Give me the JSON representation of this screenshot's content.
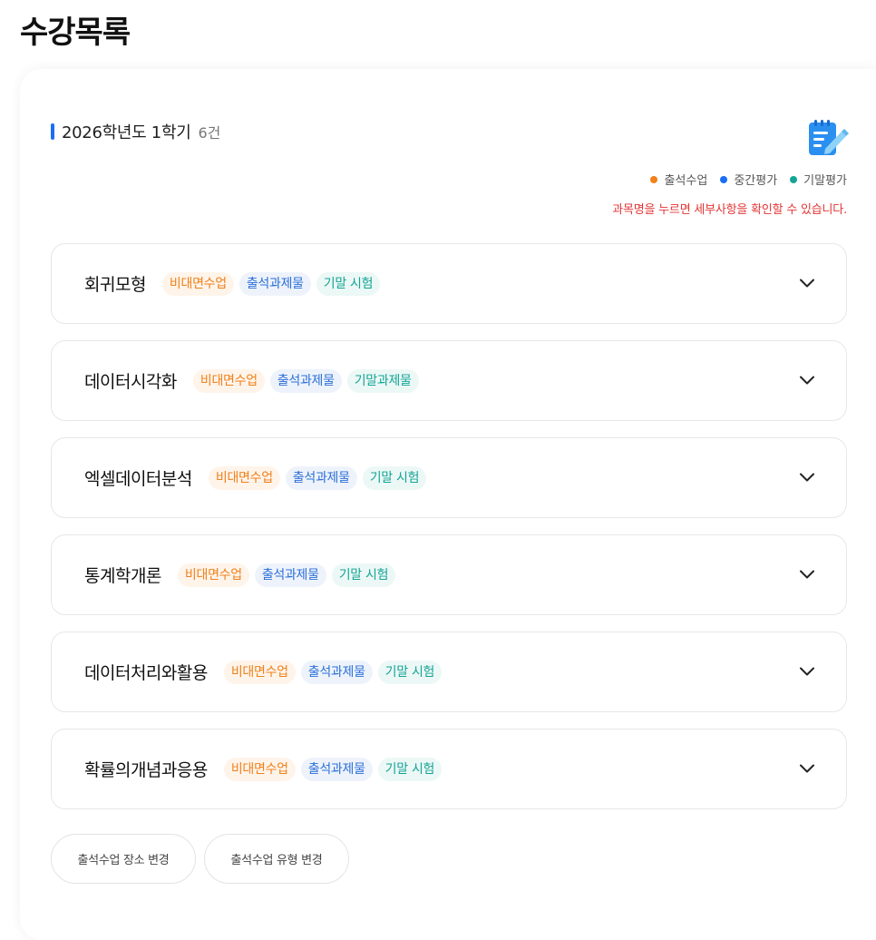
{
  "page": {
    "title": "수강목록"
  },
  "term": {
    "label": "2026학년도 1학기",
    "count": "6건"
  },
  "legend": [
    {
      "label": "출석수업",
      "color": "#f0811b"
    },
    {
      "label": "중간평가",
      "color": "#1a6ef5"
    },
    {
      "label": "기말평가",
      "color": "#14a495"
    }
  ],
  "notice": "과목명을 누르면 세부사항을 확인할 수 있습니다.",
  "courses": [
    {
      "name": "회귀모형",
      "tags": [
        "비대면수업",
        "출석과제물",
        "기말 시험"
      ]
    },
    {
      "name": "데이터시각화",
      "tags": [
        "비대면수업",
        "출석과제물",
        "기말과제물"
      ]
    },
    {
      "name": "엑셀데이터분석",
      "tags": [
        "비대면수업",
        "출석과제물",
        "기말 시험"
      ]
    },
    {
      "name": "통계학개론",
      "tags": [
        "비대면수업",
        "출석과제물",
        "기말 시험"
      ]
    },
    {
      "name": "데이터처리와활용",
      "tags": [
        "비대면수업",
        "출석과제물",
        "기말 시험"
      ]
    },
    {
      "name": "확률의개념과응용",
      "tags": [
        "비대면수업",
        "출석과제물",
        "기말 시험"
      ]
    }
  ],
  "buttons": {
    "change_location": "출석수업 장소 변경",
    "change_type": "출석수업 유형 변경"
  },
  "icons": {
    "memo": "memo-edit-icon",
    "expand": "chevron-down-icon"
  }
}
